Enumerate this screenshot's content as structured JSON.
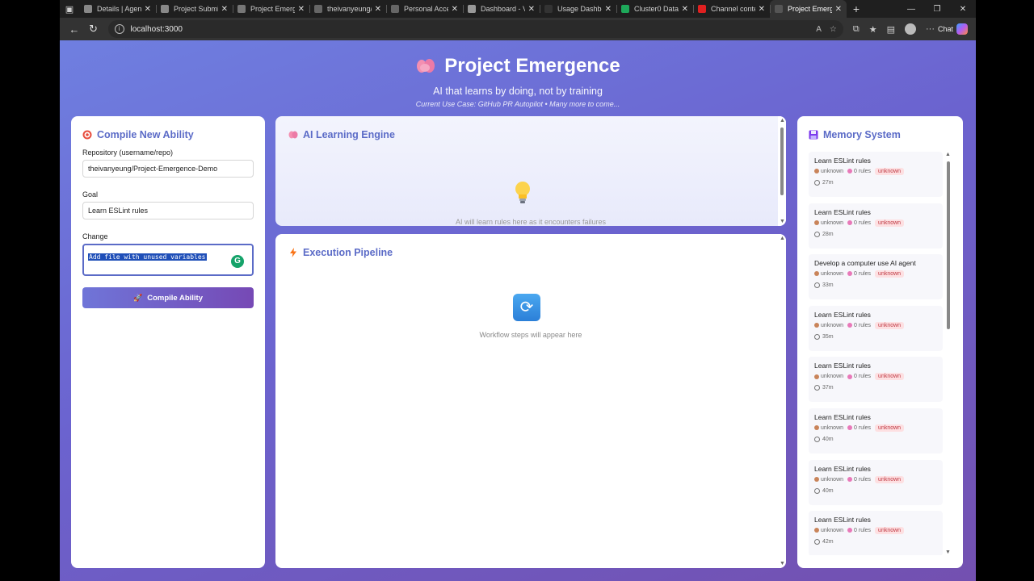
{
  "browser": {
    "tabs": [
      {
        "title": "Details | Agent",
        "fav": "#888"
      },
      {
        "title": "Project Submis",
        "fav": "#888"
      },
      {
        "title": "Project Emerge",
        "fav": "#777"
      },
      {
        "title": "theivanyeung/",
        "fav": "#666"
      },
      {
        "title": "Personal Acces",
        "fav": "#666"
      },
      {
        "title": "Dashboard - V",
        "fav": "#999"
      },
      {
        "title": "Usage Dashbo",
        "fav": "#333"
      },
      {
        "title": "Cluster0 Data",
        "fav": "#1ea85a"
      },
      {
        "title": "Channel conte",
        "fav": "#e02020"
      },
      {
        "title": "Project Emerg",
        "fav": "#555"
      }
    ],
    "url": "localhost:3000",
    "chat_label": "Chat"
  },
  "hero": {
    "title": "Project Emergence",
    "subtitle": "AI that learns by doing, not by training",
    "use_case": "Current Use Case: GitHub PR Autopilot • Many more to come..."
  },
  "compile": {
    "title": "Compile New Ability",
    "repo_label": "Repository (username/repo)",
    "repo_value": "theivanyeung/Project-Emergence-Demo",
    "goal_label": "Goal",
    "goal_value": "Learn ESLint rules",
    "change_label": "Change",
    "change_value": "Add file with unused variables",
    "button_label": "Compile Ability"
  },
  "learning": {
    "title": "AI Learning Engine",
    "empty_text": "AI will learn rules here as it encounters failures"
  },
  "pipeline": {
    "title": "Execution Pipeline",
    "empty_text": "Workflow steps will appear here"
  },
  "memory": {
    "title": "Memory System",
    "items": [
      {
        "title": "Learn ESLint rules",
        "status": "unknown",
        "rules": "0 rules",
        "badge": "unknown",
        "time": "27m"
      },
      {
        "title": "Learn ESLint rules",
        "status": "unknown",
        "rules": "0 rules",
        "badge": "unknown",
        "time": "28m"
      },
      {
        "title": "Develop a computer use AI agent",
        "status": "unknown",
        "rules": "0 rules",
        "badge": "unknown",
        "time": "33m"
      },
      {
        "title": "Learn ESLint rules",
        "status": "unknown",
        "rules": "0 rules",
        "badge": "unknown",
        "time": "35m"
      },
      {
        "title": "Learn ESLint rules",
        "status": "unknown",
        "rules": "0 rules",
        "badge": "unknown",
        "time": "37m"
      },
      {
        "title": "Learn ESLint rules",
        "status": "unknown",
        "rules": "0 rules",
        "badge": "unknown",
        "time": "40m"
      },
      {
        "title": "Learn ESLint rules",
        "status": "unknown",
        "rules": "0 rules",
        "badge": "unknown",
        "time": "40m"
      },
      {
        "title": "Learn ESLint rules",
        "status": "unknown",
        "rules": "0 rules",
        "badge": "unknown",
        "time": "42m"
      }
    ]
  },
  "colors": {
    "accent": "#5b6bc7",
    "badge_bg": "#fde0e2",
    "badge_text": "#c03a44"
  }
}
